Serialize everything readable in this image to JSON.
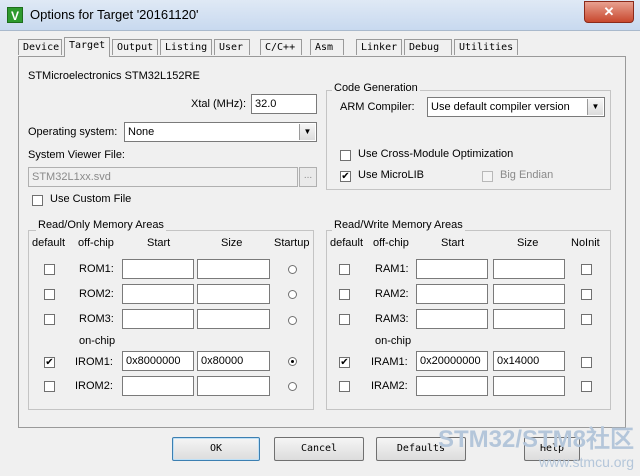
{
  "window": {
    "title": "Options for Target '20161120'",
    "app_icon": "keil-uvision-icon",
    "close_label": "✕"
  },
  "tabs": [
    {
      "label": "Device"
    },
    {
      "label": "Target"
    },
    {
      "label": "Output"
    },
    {
      "label": "Listing"
    },
    {
      "label": "User"
    },
    {
      "label": "C/C++"
    },
    {
      "label": "Asm"
    },
    {
      "label": "Linker"
    },
    {
      "label": "Debug"
    },
    {
      "label": "Utilities"
    }
  ],
  "active_tab": "Target",
  "device_name": "STMicroelectronics STM32L152RE",
  "xtal": {
    "label": "Xtal (MHz):",
    "value": "32.0"
  },
  "os": {
    "label": "Operating system:",
    "value": "None"
  },
  "svd": {
    "label": "System Viewer File:",
    "value": "STM32L1xx.svd",
    "browse": "...",
    "use_custom_label": "Use Custom File",
    "use_custom_checked": false
  },
  "code_gen": {
    "title": "Code Generation",
    "compiler_label": "ARM Compiler:",
    "compiler_value": "Use default compiler version",
    "cross_module_label": "Use Cross-Module Optimization",
    "cross_module_checked": false,
    "microlib_label": "Use MicroLIB",
    "microlib_checked": true,
    "big_endian_label": "Big Endian",
    "big_endian_checked": false
  },
  "ro_memory": {
    "title": "Read/Only Memory Areas",
    "headers": {
      "default": "default",
      "offchip": "off-chip",
      "start": "Start",
      "size": "Size",
      "startup": "Startup"
    },
    "onchip_label": "on-chip",
    "rows": [
      {
        "name": "ROM1:",
        "checked": false,
        "start": "",
        "size": "",
        "startup": false
      },
      {
        "name": "ROM2:",
        "checked": false,
        "start": "",
        "size": "",
        "startup": false
      },
      {
        "name": "ROM3:",
        "checked": false,
        "start": "",
        "size": "",
        "startup": false
      },
      {
        "name": "IROM1:",
        "checked": true,
        "start": "0x8000000",
        "size": "0x80000",
        "startup": true
      },
      {
        "name": "IROM2:",
        "checked": false,
        "start": "",
        "size": "",
        "startup": false
      }
    ]
  },
  "rw_memory": {
    "title": "Read/Write Memory Areas",
    "headers": {
      "default": "default",
      "offchip": "off-chip",
      "start": "Start",
      "size": "Size",
      "noinit": "NoInit"
    },
    "onchip_label": "on-chip",
    "rows": [
      {
        "name": "RAM1:",
        "checked": false,
        "start": "",
        "size": "",
        "noinit": false
      },
      {
        "name": "RAM2:",
        "checked": false,
        "start": "",
        "size": "",
        "noinit": false
      },
      {
        "name": "RAM3:",
        "checked": false,
        "start": "",
        "size": "",
        "noinit": false
      },
      {
        "name": "IRAM1:",
        "checked": true,
        "start": "0x20000000",
        "size": "0x14000",
        "noinit": false
      },
      {
        "name": "IRAM2:",
        "checked": false,
        "start": "",
        "size": "",
        "noinit": false
      }
    ]
  },
  "buttons": {
    "ok": "OK",
    "cancel": "Cancel",
    "defaults": "Defaults",
    "help": "Help"
  },
  "check_mark": "✔",
  "watermark": {
    "line1": "STM32/STM8社区",
    "line2": "www.stmcu.org"
  }
}
